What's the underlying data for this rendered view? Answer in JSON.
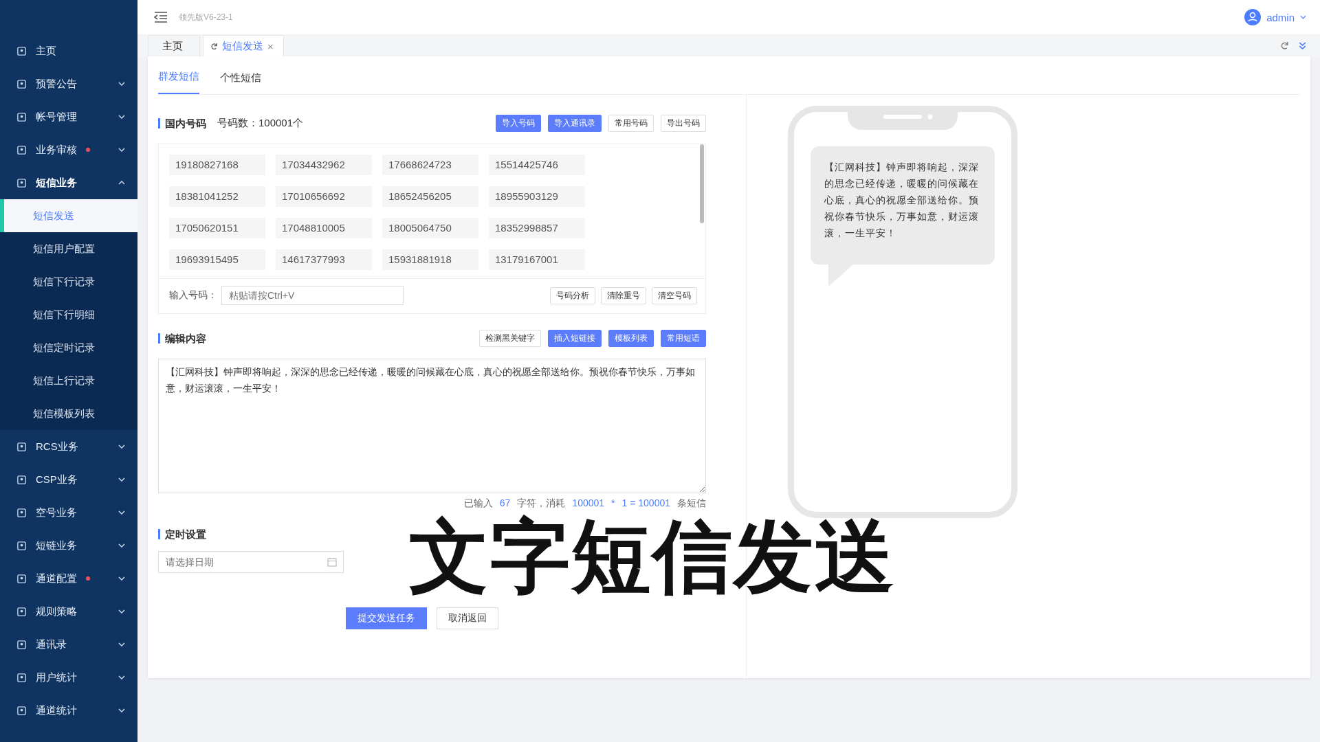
{
  "header": {
    "version": "领先版V6-23-1",
    "user": "admin"
  },
  "sidebar": {
    "items": [
      {
        "label": "主页"
      },
      {
        "label": "预警公告",
        "expanded": false,
        "alert": false
      },
      {
        "label": "帐号管理",
        "expanded": false,
        "alert": false
      },
      {
        "label": "业务审核",
        "expanded": false,
        "alert": true
      },
      {
        "label": "短信业务",
        "expanded": true,
        "alert": false,
        "children": [
          {
            "label": "短信发送",
            "selected": true
          },
          {
            "label": "短信用户配置",
            "selected": false
          },
          {
            "label": "短信下行记录",
            "selected": false
          },
          {
            "label": "短信下行明细",
            "selected": false
          },
          {
            "label": "短信定时记录",
            "selected": false
          },
          {
            "label": "短信上行记录",
            "selected": false
          },
          {
            "label": "短信模板列表",
            "selected": false
          }
        ]
      },
      {
        "label": "RCS业务",
        "expanded": false,
        "alert": false
      },
      {
        "label": "CSP业务",
        "expanded": false,
        "alert": false
      },
      {
        "label": "空号业务",
        "expanded": false,
        "alert": false
      },
      {
        "label": "短链业务",
        "expanded": false,
        "alert": false
      },
      {
        "label": "通道配置",
        "expanded": false,
        "alert": true
      },
      {
        "label": "规则策略",
        "expanded": false,
        "alert": false
      },
      {
        "label": "通讯录",
        "expanded": false,
        "alert": false
      },
      {
        "label": "用户统计",
        "expanded": false,
        "alert": false
      },
      {
        "label": "通道统计",
        "expanded": false,
        "alert": false
      }
    ]
  },
  "page_tabs": [
    {
      "label": "主页",
      "selected": false
    },
    {
      "label": "短信发送",
      "selected": true,
      "close": "×"
    }
  ],
  "sub_tabs": [
    {
      "label": "群发短信",
      "selected": true
    },
    {
      "label": "个性短信",
      "selected": false
    }
  ],
  "numbers": {
    "title": "国内号码",
    "count": "号码数：100001个",
    "buttons": [
      {
        "label": "导入号码",
        "primary": true
      },
      {
        "label": "导入通讯录",
        "primary": true
      },
      {
        "label": "常用号码",
        "primary": false
      },
      {
        "label": "导出号码",
        "primary": false
      }
    ],
    "list": [
      "19180827168",
      "17034432962",
      "17668624723",
      "15514425746",
      "18381041252",
      "17010656692",
      "18652456205",
      "18955903129",
      "17050620151",
      "17048810005",
      "18005064750",
      "18352998857",
      "19693915495",
      "14617377993",
      "15931881918",
      "13179167001"
    ],
    "input_label": "输入号码：",
    "input_placeholder": "粘贴请按Ctrl+V",
    "tools": [
      "号码分析",
      "清除重号",
      "清空号码"
    ]
  },
  "content": {
    "title": "编辑内容",
    "buttons": [
      {
        "label": "检测黑关键字",
        "primary": false
      },
      {
        "label": "插入短链接",
        "primary": true
      },
      {
        "label": "模板列表",
        "primary": true
      },
      {
        "label": "常用短语",
        "primary": true
      }
    ],
    "text": "【汇网科技】钟声即将响起，深深的思念已经传递，暖暖的问候藏在心底，真心的祝愿全部送给你。预祝你春节快乐，万事如意，财运滚滚，一生平安！",
    "counter": [
      {
        "text": "已输入",
        "highlight": false
      },
      {
        "text": "67",
        "highlight": true
      },
      {
        "text": "字符，消耗",
        "highlight": false
      },
      {
        "text": "100001",
        "highlight": true
      },
      {
        "text": "*",
        "highlight": true
      },
      {
        "text": "1 = 100001",
        "highlight": true
      },
      {
        "text": "条短信",
        "highlight": false
      }
    ]
  },
  "schedule": {
    "title": "定时设置",
    "placeholder": "请选择日期"
  },
  "actions": [
    {
      "label": "提交发送任务",
      "primary": true
    },
    {
      "label": "取消返回",
      "primary": false
    }
  ],
  "preview": {
    "message": "【汇网科技】钟声即将响起，深深的思念已经传递，暖暖的问候藏在心底，真心的祝愿全部送给你。预祝你春节快乐，万事如意，财运滚滚，一生平安！"
  },
  "caption": "文字短信发送"
}
